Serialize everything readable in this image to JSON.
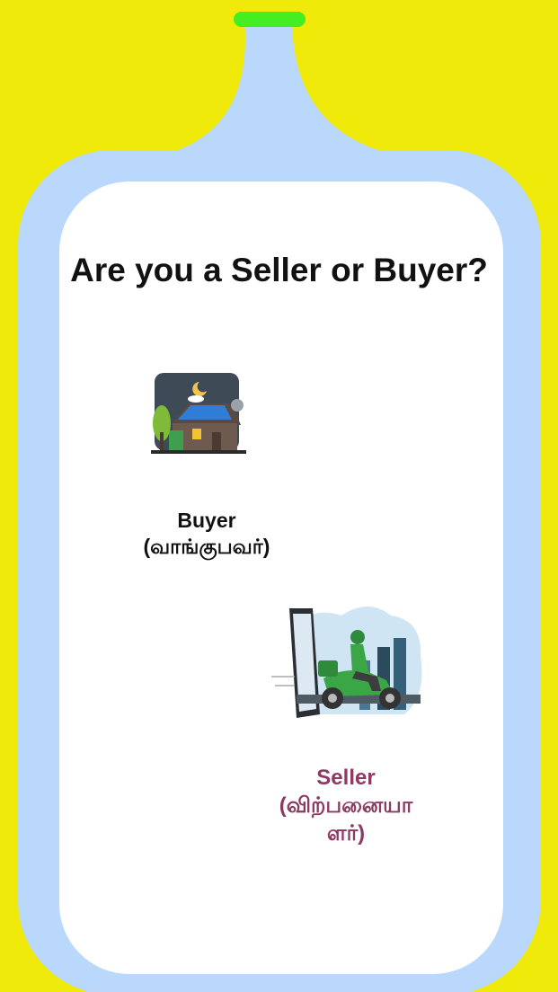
{
  "question": "Are you a Seller or Buyer?",
  "options": [
    {
      "id": "buyer",
      "title": "Buyer",
      "subtitle": "(வாங்குபவர்)",
      "color": "#111111",
      "icon": "house-icon"
    },
    {
      "id": "seller",
      "title": "Seller",
      "subtitle_line1": "(விற்பனையா",
      "subtitle_line2": "ளர்)",
      "color": "#8c3a63",
      "icon": "delivery-scooter-icon"
    }
  ],
  "colors": {
    "background": "#f0ea0a",
    "bottle": "#b9d8fb",
    "card": "#ffffff",
    "cap": "#44ee22"
  }
}
